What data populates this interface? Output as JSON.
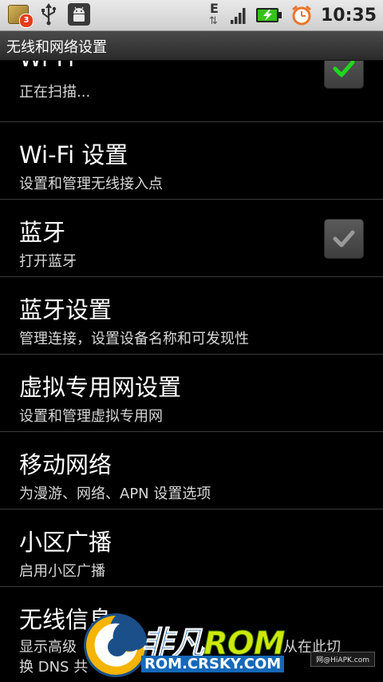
{
  "status_bar": {
    "notification_count": "3",
    "network_type": "E",
    "time": "10:35",
    "icons": [
      "app-notification-icon",
      "usb-icon",
      "android-debug-icon",
      "data-activity-icon",
      "signal-icon",
      "battery-charging-icon",
      "alarm-icon"
    ],
    "battery_color": "#36c21b"
  },
  "title_bar": {
    "title": "无线和网络设置"
  },
  "items": [
    {
      "title": "Wi-Fi",
      "subtitle": "正在扫描...",
      "checkbox": true,
      "checked": true
    },
    {
      "title": "Wi-Fi 设置",
      "subtitle": "设置和管理无线接入点",
      "checkbox": false
    },
    {
      "title": "蓝牙",
      "subtitle": "打开蓝牙",
      "checkbox": true,
      "checked": false
    },
    {
      "title": "蓝牙设置",
      "subtitle": "管理连接，设置设备名称和可发现性",
      "checkbox": false
    },
    {
      "title": "虚拟专用网设置",
      "subtitle": "设置和管理虚拟专用网",
      "checkbox": false
    },
    {
      "title": "移动网络",
      "subtitle": "为漫游、网络、APN 设置选项",
      "checkbox": false
    },
    {
      "title": "小区广播",
      "subtitle": "启用小区广播",
      "checkbox": false
    },
    {
      "title": "无线信息",
      "subtitle": "显示高级",
      "subtitle_right": "从在此切",
      "subtitle2": "换 DNS 共",
      "checkbox": false
    }
  ],
  "watermark": {
    "brand_a": "非凡",
    "brand_b": "ROM",
    "url": "ROM.CRSKY.COM",
    "hiapk": "网@HiAPK.com"
  },
  "colors": {
    "check_green": "#1fd81f",
    "check_gray": "#9a9a9a"
  }
}
